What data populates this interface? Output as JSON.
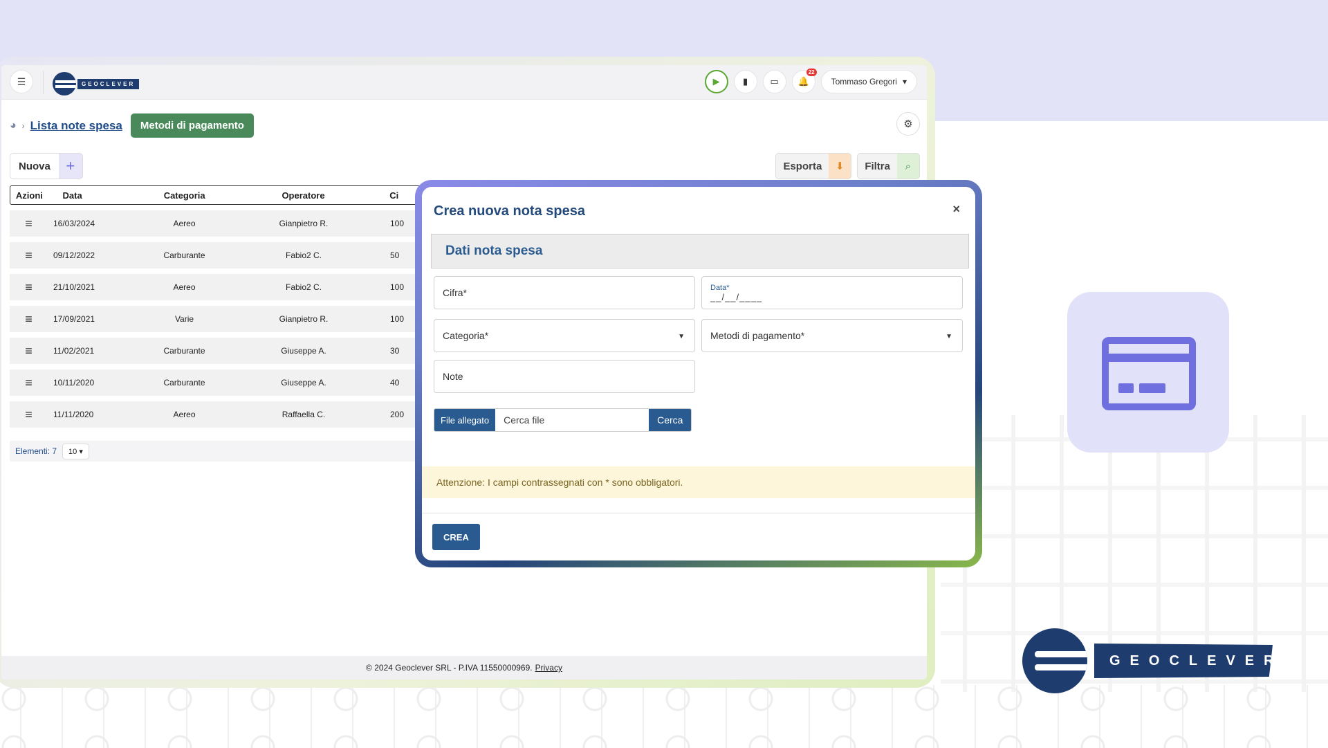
{
  "colors": {
    "brand_navy": "#1f3c6e",
    "primary_blue": "#2a5b90",
    "green_button": "#4a8a5a",
    "accent_purple": "#6f6fe0",
    "warning_bg": "#fdf6da",
    "notification_red": "#e53935"
  },
  "header": {
    "logo_text": "GEOCLEVER",
    "notification_count": "22",
    "user_name": "Tommaso Gregori",
    "icons": [
      "menu-icon",
      "play-icon",
      "note-icon",
      "laptop-icon",
      "bell-icon",
      "chevron-down-icon"
    ]
  },
  "breadcrumb": {
    "link": "Lista note spesa",
    "active_button": "Metodi di pagamento"
  },
  "toolbar": {
    "new_label": "Nuova",
    "new_icon": "+",
    "export_label": "Esporta",
    "filter_label": "Filtra"
  },
  "table": {
    "columns": [
      "Azioni",
      "Data",
      "Categoria",
      "Operatore",
      "Ci"
    ],
    "rows": [
      {
        "data": "16/03/2024",
        "categoria": "Aereo",
        "operatore": "Gianpietro R.",
        "cifra": "100"
      },
      {
        "data": "09/12/2022",
        "categoria": "Carburante",
        "operatore": "Fabio2 C.",
        "cifra": "50"
      },
      {
        "data": "21/10/2021",
        "categoria": "Aereo",
        "operatore": "Fabio2 C.",
        "cifra": "100"
      },
      {
        "data": "17/09/2021",
        "categoria": "Varie",
        "operatore": "Gianpietro R.",
        "cifra": "100"
      },
      {
        "data": "11/02/2021",
        "categoria": "Carburante",
        "operatore": "Giuseppe A.",
        "cifra": "30"
      },
      {
        "data": "10/11/2020",
        "categoria": "Carburante",
        "operatore": "Giuseppe A.",
        "cifra": "40"
      },
      {
        "data": "11/11/2020",
        "categoria": "Aereo",
        "operatore": "Raffaella C.",
        "cifra": "200"
      }
    ],
    "pager_label": "Elementi: 7",
    "page_size": "10"
  },
  "footer": {
    "text": "© 2024 Geoclever SRL - P.IVA 11550000969.",
    "privacy": "Privacy"
  },
  "modal": {
    "title": "Crea nuova nota spesa",
    "close": "×",
    "section": "Dati nota spesa",
    "cifra_placeholder": "Cifra*",
    "data_label": "Data*",
    "data_mask": "__/__/____",
    "categoria_placeholder": "Categoria*",
    "metodi_placeholder": "Metodi di pagamento*",
    "note_placeholder": "Note",
    "file_label": "File allegato",
    "file_placeholder": "Cerca file",
    "file_button": "Cerca",
    "warning": "Attenzione: I campi contrassegnati con * sono obbligatori.",
    "submit": "CREA"
  },
  "branding": {
    "logo_text": "GEOCLEVER",
    "tile_icon": "credit-card-icon"
  }
}
